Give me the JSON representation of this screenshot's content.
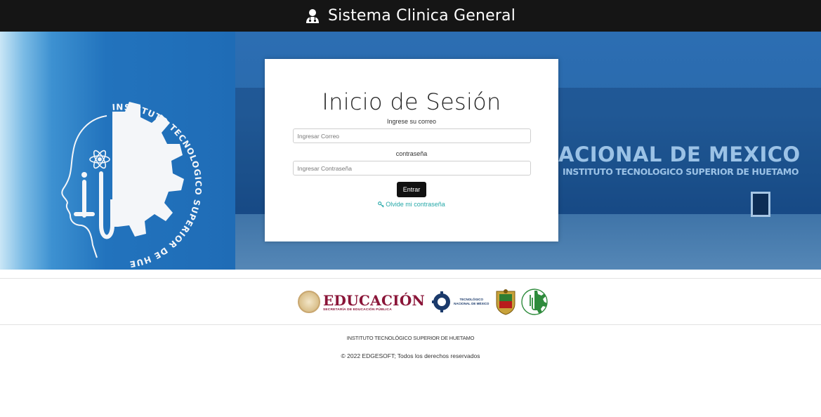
{
  "header": {
    "brand_icon": "user-doctor-icon",
    "title": "Sistema Clinica General"
  },
  "hero": {
    "logo_ring_text": "INSTITUTO TECNOLOGICO SUPERIOR DE HUETAMO",
    "sign_main": "ACIONAL DE MEXICO",
    "sign_sub": "INSTITUTO TECNOLOGICO SUPERIOR DE HUETAMO"
  },
  "login": {
    "title": "Inicio de Sesión",
    "email_label": "Ingrese su correo",
    "email_placeholder": "Ingresar Correo",
    "email_value": "",
    "password_label": "contraseña",
    "password_placeholder": "Ingresar Contraseña",
    "password_value": "",
    "submit_label": "Entrar",
    "forgot_icon": "key-icon",
    "forgot_label": "Olvide mi contraseña"
  },
  "logos": {
    "education_title": "EDUCACIÓN",
    "education_subtitle": "SECRETARÍA DE EDUCACIÓN PÚBLICA",
    "tecnm_line1": "TECNOLÓGICO",
    "tecnm_line2": "NACIONAL DE MÉXICO"
  },
  "footer": {
    "institution": "INSTITUTO TECNOLÓGICO SUPERIOR DE HUETAMO",
    "copyright": "© 2022 EDGESOFT; Todos los derechos reservados"
  },
  "colors": {
    "topbar": "#151515",
    "button": "#111111",
    "link": "#25a8a8",
    "education": "#8a1538"
  }
}
